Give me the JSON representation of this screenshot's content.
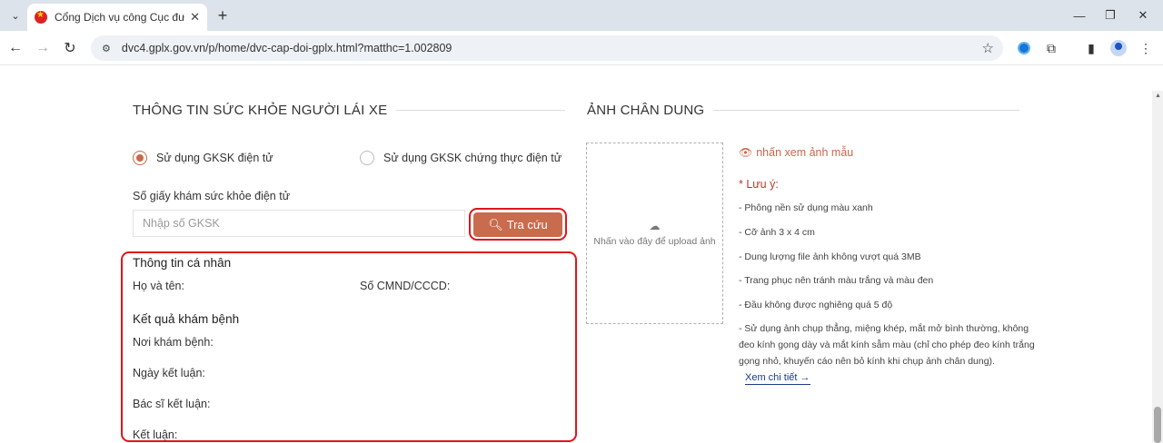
{
  "browser": {
    "tab_title": "Cổng Dịch vụ công Cục đường",
    "url": "dvc4.gplx.gov.vn/p/home/dvc-cap-doi-gplx.html?matthc=1.002809"
  },
  "health": {
    "section_title": "THÔNG TIN SỨC KHỎE NGƯỜI LÁI XE",
    "radio_electronic": "Sử dụng GKSK điện tử",
    "radio_certified": "Sử dụng GKSK chứng thực điện tử",
    "number_label": "Số giấy khám sức khỏe điện tử",
    "number_placeholder": "Nhập số GKSK",
    "search_button": "Tra cứu"
  },
  "personal": {
    "title": "Thông tin cá nhân",
    "name_label": "Họ và tên:",
    "id_label": "Số CMND/CCCD:"
  },
  "result": {
    "title": "Kết quả khám bệnh",
    "place_label": "Nơi khám bệnh:",
    "date_label": "Ngày kết luận:",
    "doctor_label": "Bác sĩ kết luận:",
    "conclusion_label": "Kết luận:"
  },
  "portrait": {
    "section_title": "ẢNH CHÂN DUNG",
    "upload_text": "Nhấn vào đây để upload ảnh",
    "sample_link": "nhấn xem ảnh mẫu",
    "note_title": "* Lưu ý:",
    "notes": [
      "- Phông nền sử dụng màu xanh",
      "- Cỡ ảnh 3 x 4 cm",
      "- Dung lượng file ảnh không vượt quá 3MB",
      "- Trang phục nên tránh màu trắng và màu đen",
      "- Đầu không được nghiêng quá 5 độ",
      "- Sử dụng ảnh chụp thẳng, miệng khép, mắt mở bình thường, không",
      "đeo kính gọng dày và mắt kính sẫm màu (chỉ cho phép đeo kính trắng",
      "gọng nhỏ, khuyến cáo nên bỏ kính khi chụp ảnh chân dung)."
    ],
    "more_link": "Xem chi tiết →"
  },
  "colors": {
    "accent": "#c96b4d",
    "highlight_frame": "#e0151b"
  }
}
